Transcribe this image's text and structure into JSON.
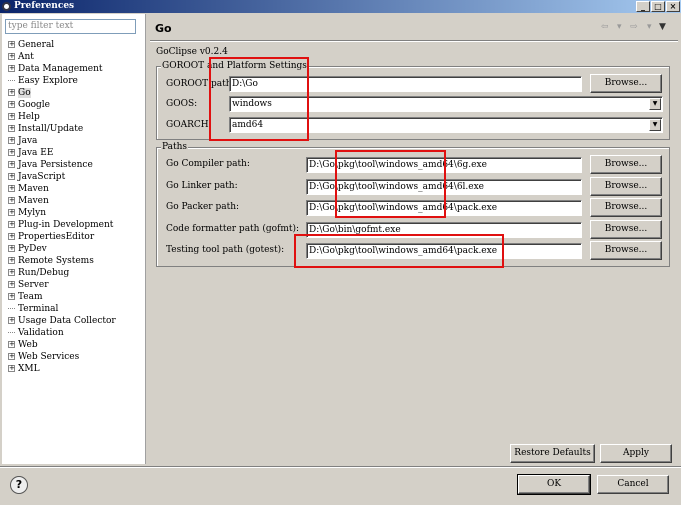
{
  "window": {
    "title": "Preferences",
    "minimize": "_",
    "maximize": "□",
    "close": "×"
  },
  "sidebar": {
    "filter_placeholder": "type filter text",
    "items": [
      {
        "label": "General",
        "expandable": true
      },
      {
        "label": "Ant",
        "expandable": true
      },
      {
        "label": "Data Management",
        "expandable": true
      },
      {
        "label": "Easy Explore",
        "expandable": false
      },
      {
        "label": "Go",
        "expandable": true,
        "selected": true
      },
      {
        "label": "Google",
        "expandable": true
      },
      {
        "label": "Help",
        "expandable": true
      },
      {
        "label": "Install/Update",
        "expandable": true
      },
      {
        "label": "Java",
        "expandable": true
      },
      {
        "label": "Java EE",
        "expandable": true
      },
      {
        "label": "Java Persistence",
        "expandable": true
      },
      {
        "label": "JavaScript",
        "expandable": true
      },
      {
        "label": "Maven",
        "expandable": true
      },
      {
        "label": "Maven",
        "expandable": true
      },
      {
        "label": "Mylyn",
        "expandable": true
      },
      {
        "label": "Plug-in Development",
        "expandable": true
      },
      {
        "label": "PropertiesEditor",
        "expandable": true
      },
      {
        "label": "PyDev",
        "expandable": true
      },
      {
        "label": "Remote Systems",
        "expandable": true
      },
      {
        "label": "Run/Debug",
        "expandable": true
      },
      {
        "label": "Server",
        "expandable": true
      },
      {
        "label": "Team",
        "expandable": true
      },
      {
        "label": "Terminal",
        "expandable": false
      },
      {
        "label": "Usage Data Collector",
        "expandable": true
      },
      {
        "label": "Validation",
        "expandable": false
      },
      {
        "label": "Web",
        "expandable": true
      },
      {
        "label": "Web Services",
        "expandable": true
      },
      {
        "label": "XML",
        "expandable": true
      }
    ]
  },
  "page": {
    "title": "Go",
    "nav": {
      "back": "⇦",
      "back_menu": "▾",
      "forward": "⇨",
      "forward_menu": "▾",
      "menu": "▼"
    },
    "version": "GoClipse v0.2.4",
    "goroot_group": {
      "title": "GOROOT and Platform Settings",
      "goroot_label": "GOROOT path:",
      "goroot_value": "D:\\Go",
      "goos_label": "GOOS:",
      "goos_value": "windows",
      "goarch_label": "GOARCH:",
      "goarch_value": "amd64"
    },
    "paths_group": {
      "title": "Paths",
      "rows": [
        {
          "label": "Go Compiler path:",
          "value": "D:\\Go\\pkg\\tool\\windows_amd64\\6g.exe"
        },
        {
          "label": "Go Linker path:",
          "value": "D:\\Go\\pkg\\tool\\windows_amd64\\6l.exe"
        },
        {
          "label": "Go Packer path:",
          "value": "D:\\Go\\pkg\\tool\\windows_amd64\\pack.exe"
        },
        {
          "label": "Code formatter path (gofmt):",
          "value": "D:\\Go\\bin\\gofmt.exe"
        },
        {
          "label": "Testing tool path (gotest):",
          "value": "D:\\Go\\pkg\\tool\\windows_amd64\\pack.exe"
        }
      ]
    },
    "browse_label": "Browse...",
    "restore_defaults": "Restore Defaults",
    "apply": "Apply"
  },
  "footer": {
    "help": "?",
    "ok": "OK",
    "cancel": "Cancel"
  },
  "annotation_color": "#e01010"
}
